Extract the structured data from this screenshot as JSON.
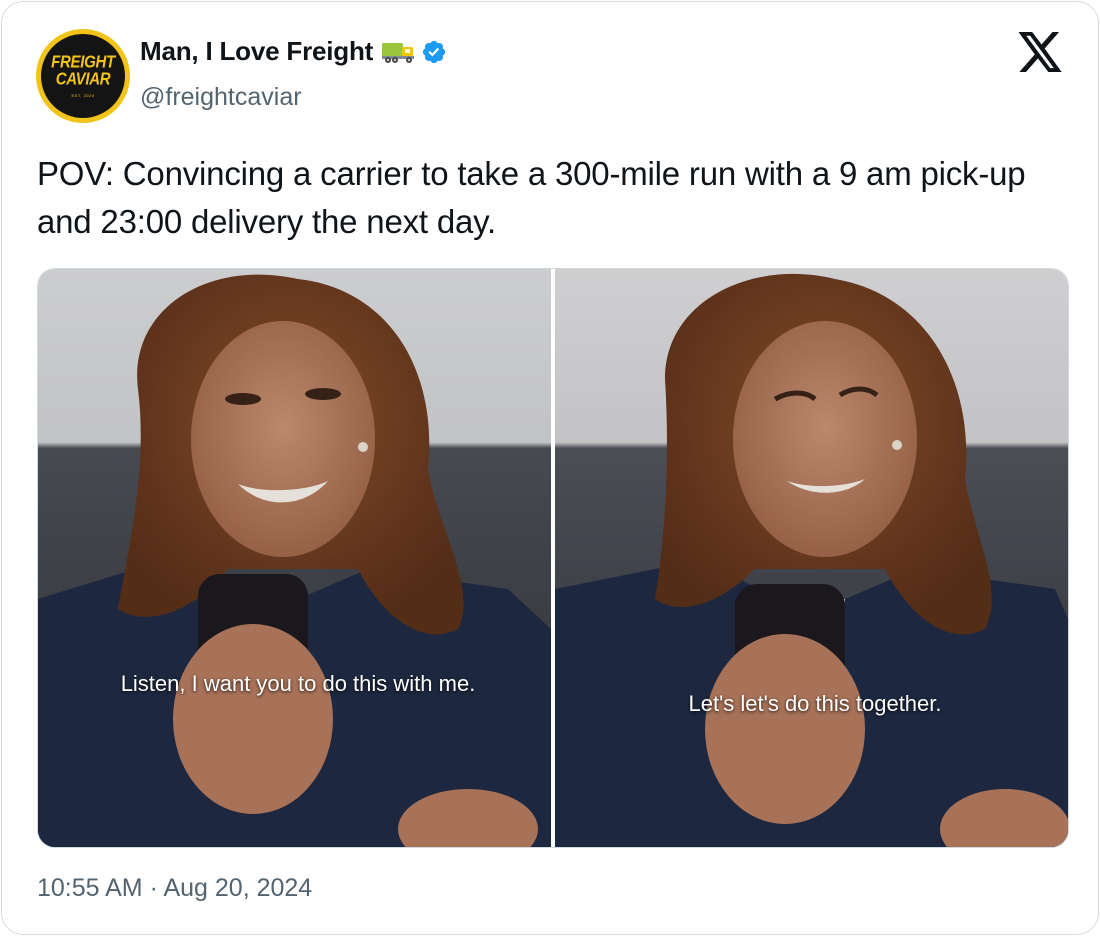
{
  "colors": {
    "verified_badge": "#1d9bf0",
    "avatar_brand_yellow": "#f2c318",
    "text_primary": "#0f1419",
    "text_secondary": "#536471"
  },
  "author": {
    "avatar_line_1": "FREIGHT",
    "avatar_line_2": "CAVIAR",
    "avatar_est": "EST. 2020",
    "display_name": "Man, I Love Freight",
    "name_emoji_icon": "truck-icon",
    "verified_icon": "verified-badge-icon",
    "handle": "@freightcaviar"
  },
  "platform": {
    "logo_icon": "x-logo-icon"
  },
  "tweet": {
    "text": "POV: Convincing a carrier to take a 300-mile run with a 9 am pick-up and 23:00 delivery the next day.",
    "timestamp": "10:55 AM · Aug 20, 2024"
  },
  "media": {
    "panels": [
      {
        "caption": "Listen, I want you to do this with me."
      },
      {
        "caption": "Let's let's do this together."
      }
    ]
  }
}
